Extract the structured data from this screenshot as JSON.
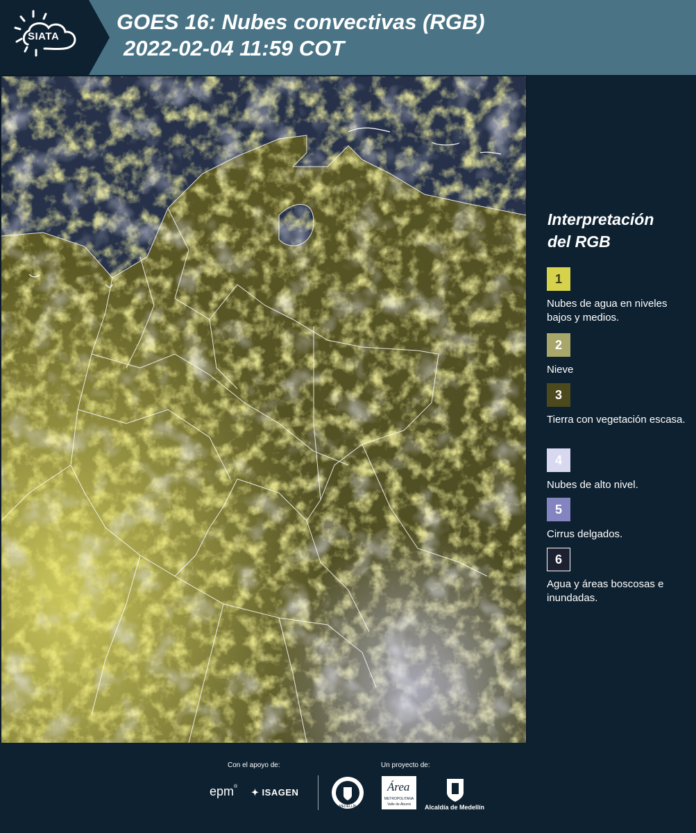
{
  "header": {
    "logo_text": "SIATA",
    "title_line1": "GOES 16: Nubes convectivas (RGB)",
    "title_line2": "2022-02-04 11:59 COT"
  },
  "legend": {
    "title_line1": "Interpretación",
    "title_line2": "del RGB",
    "items": [
      {
        "number": "1",
        "label": "Nubes de agua en niveles bajos y medios.",
        "color": "#d6d24c",
        "text_color": "#3c3a10"
      },
      {
        "number": "2",
        "label": "Nieve",
        "color": "#a9a66a",
        "text_color": "#ffffff"
      },
      {
        "number": "3",
        "label": "Tierra con vegetación escasa.",
        "color": "#4c4a1c",
        "text_color": "#ffffff"
      },
      {
        "number": "4",
        "label": "Nubes de alto nivel.",
        "color": "#d8d8f0",
        "text_color": "#ffffff"
      },
      {
        "number": "5",
        "label": "Cirrus delgados.",
        "color": "#8484c0",
        "text_color": "#ffffff"
      },
      {
        "number": "6",
        "label": "Agua y áreas boscosas e inundadas.",
        "color": "#1c2030",
        "text_color": "#ffffff"
      }
    ]
  },
  "footer": {
    "support_label": "Con el apoyo de:",
    "project_label": "Un proyecto de:",
    "sponsor_epm": "epm",
    "sponsor_isagen": "ISAGEN",
    "area_name": "Área",
    "area_sub1": "METROPOLITANA",
    "area_sub2": "Valle de Aburrá",
    "alcaldia": "Alcaldía de Medellín",
    "seal_text": "MEDELLÍN"
  }
}
